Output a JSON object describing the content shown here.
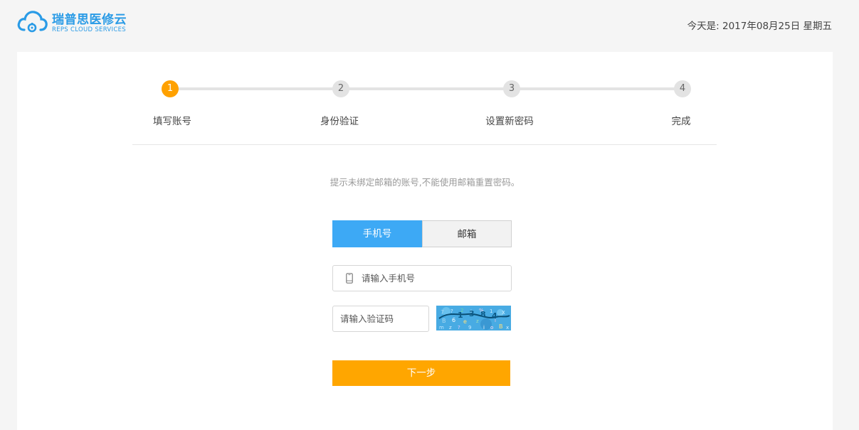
{
  "header": {
    "logo_cn": "瑞普思医修云",
    "logo_en": "REPS CLOUD SERVICES",
    "date_text": "今天是: 2017年08月25日 星期五"
  },
  "steps": [
    {
      "number": "1",
      "label": "填写账号",
      "active": true
    },
    {
      "number": "2",
      "label": "身份验证",
      "active": false
    },
    {
      "number": "3",
      "label": "设置新密码",
      "active": false
    },
    {
      "number": "4",
      "label": "完成",
      "active": false
    }
  ],
  "hint": "提示未绑定邮箱的账号,不能使用邮箱重置密码。",
  "tabs": {
    "phone": "手机号",
    "email": "邮箱"
  },
  "form": {
    "phone_placeholder": "请输入手机号",
    "phone_value": "",
    "code_placeholder": "请输入验证码",
    "code_value": ""
  },
  "next_button": "下一步",
  "colors": {
    "brand": "#2a9be6",
    "accent": "#ffa600",
    "tab_active": "#3da9f5"
  }
}
